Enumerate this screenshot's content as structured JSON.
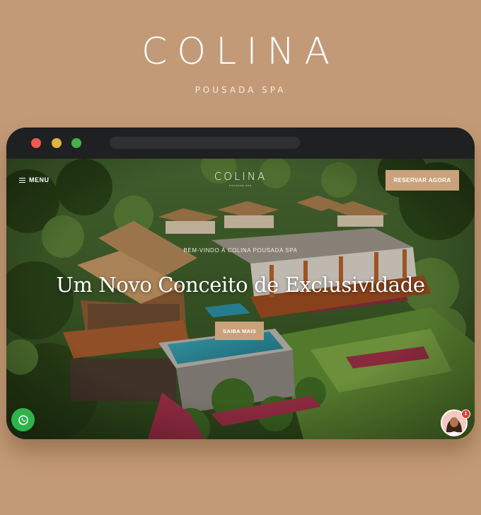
{
  "brand": {
    "logo": "COLINA",
    "subtitle": "POUSADA SPA"
  },
  "browser": {
    "window_controls": [
      "close",
      "minimize",
      "maximize"
    ],
    "url": ""
  },
  "site": {
    "menu_label": "MENU",
    "nav_logo": "COLINA",
    "nav_logo_sub": "POUSADA SPA",
    "reserve_button": "RESERVAR AGORA",
    "hero": {
      "kicker": "BEM-VINDO À COLINA POUSADA SPA",
      "title": "Um Novo Conceito de Exclusividade",
      "cta": "SAIBA MAIS"
    }
  },
  "widgets": {
    "whatsapp_icon": "whatsapp-icon",
    "chat_avatar": "avatar",
    "notification_count": "1"
  },
  "colors": {
    "page_background": "#c39a77",
    "accent": "#c9a27b",
    "browser_frame": "#1f2021",
    "whatsapp_green": "#2fb34a",
    "badge_red": "#e33b2f"
  }
}
